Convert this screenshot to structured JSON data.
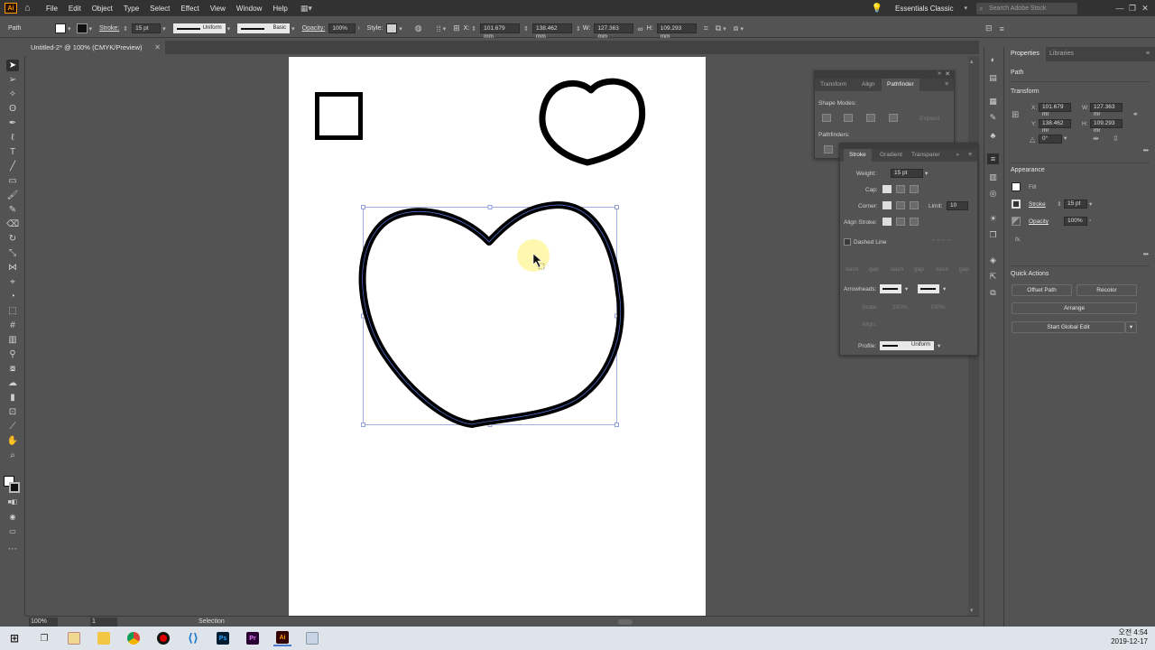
{
  "menubar": {
    "app_logo": "Ai",
    "items": [
      "File",
      "Edit",
      "Object",
      "Type",
      "Select",
      "Effect",
      "View",
      "Window",
      "Help"
    ],
    "workspace": "Essentials Classic",
    "search_placeholder": "Search Adobe Stock"
  },
  "controlbar": {
    "object_type": "Path",
    "stroke_label": "Stroke:",
    "stroke_weight": "15 pt",
    "profile_name": "Uniform",
    "brush_name": "Basic",
    "opacity_label": "Opacity:",
    "opacity_value": "100%",
    "style_label": "Style:",
    "x_label": "X:",
    "x_value": "101.679 mm",
    "y_label": "Y:",
    "y_value": "138.462 mm",
    "w_label": "W:",
    "w_value": "127.363 mm",
    "h_label": "H:",
    "h_value": "109.293 mm"
  },
  "document": {
    "tab_title": "Untitled-2* @ 100% (CMYK/Preview)"
  },
  "statusbar": {
    "zoom": "100%",
    "page": "1",
    "mode": "Selection"
  },
  "pathfinder_panel": {
    "tabs": [
      "Transform",
      "Align",
      "Pathfinder"
    ],
    "active_tab": "Pathfinder",
    "shape_modes_label": "Shape Modes:",
    "expand_label": "Expand",
    "pathfinders_label": "Pathfinders:"
  },
  "stroke_panel": {
    "tabs": [
      "Stroke",
      "Gradient",
      "Transparer"
    ],
    "weight_label": "Weight:",
    "weight_value": "15 pt",
    "cap_label": "Cap:",
    "corner_label": "Corner:",
    "limit_label": "Limit:",
    "limit_value": "10",
    "align_label": "Align Stroke:",
    "dashed_label": "Dashed Line",
    "dash_labels": [
      "dash",
      "gap",
      "dash",
      "gap",
      "dash",
      "gap"
    ],
    "arrowheads_label": "Arrowheads:",
    "scale_label": "Scale:",
    "scale_values": [
      "100%",
      "100%"
    ],
    "align_label2": "Align:",
    "profile_label": "Profile:",
    "profile_value": "Uniform"
  },
  "properties": {
    "tabs": [
      "Properties",
      "Libraries"
    ],
    "object_type": "Path",
    "transform_label": "Transform",
    "x_label": "X:",
    "x_value": "101.679 mr",
    "w_label": "W:",
    "w_value": "127.363 mr",
    "y_label": "Y:",
    "y_value": "138.462 mr",
    "h_label": "H:",
    "h_value": "109.293 mr",
    "angle_value": "0°",
    "appearance_label": "Appearance",
    "fill_label": "Fill",
    "stroke_label": "Stroke",
    "stroke_value": "15 pt",
    "opacity_label": "Opacity",
    "opacity_value": "100%",
    "fx_label": "fx.",
    "quick_actions_label": "Quick Actions",
    "btn_offset_path": "Offset Path",
    "btn_recolor": "Recolor",
    "btn_arrange": "Arrange",
    "btn_global_edit": "Start Global Edit"
  },
  "taskbar": {
    "time": "오전 4:54",
    "date": "2019-12-17",
    "apps": [
      "Ps",
      "Pr",
      "Ai"
    ]
  },
  "colors": {
    "app_bg": "#535353",
    "menubar_bg": "#323232",
    "accent_orange": "#ff9a00",
    "selection_blue": "#4a6fd8",
    "cursor_highlight": "#fff7a0"
  }
}
